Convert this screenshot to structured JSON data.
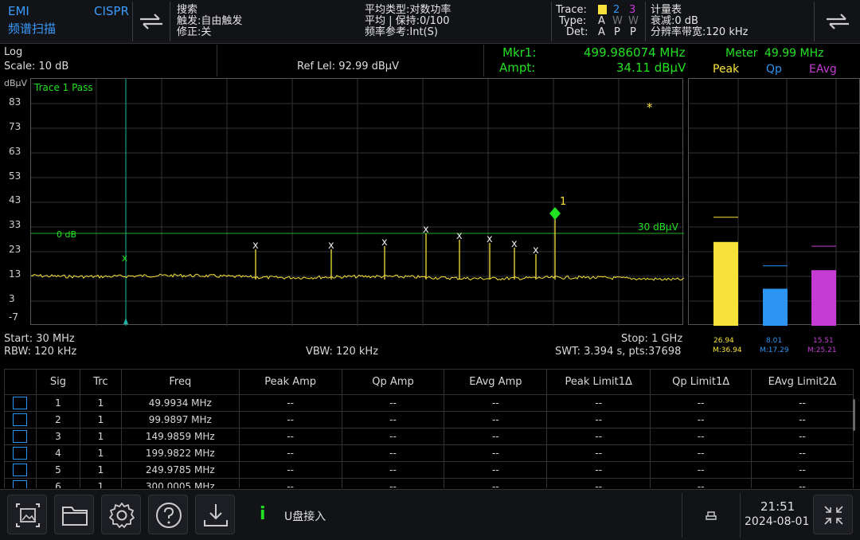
{
  "topbar": {
    "mode_title": "EMI",
    "mode_subtitle": "频谱扫描",
    "standard": "CISPR",
    "search_lines": [
      "搜索",
      "触发:自由触发",
      "修正:关"
    ],
    "avg_lines": [
      "平均类型:对数功率",
      "平均 | 保持:0/100",
      "频率参考:Int(S)"
    ],
    "trace_label": "Trace:",
    "trace_nums": [
      "2",
      "3"
    ],
    "type_label": "Type:",
    "type_values": [
      "A",
      "W",
      "W"
    ],
    "det_label": "Det:",
    "det_values": [
      "A",
      "P",
      "P"
    ],
    "meter_lines": [
      "计量表",
      "衰减:0 dB",
      "分辨率带宽:120 kHz"
    ]
  },
  "header": {
    "scale_type": "Log",
    "scale": "Scale: 10 dB",
    "ref_level": "Ref Lel: 92.99 dBμV",
    "mkr_label": "Mkr1:",
    "mkr_freq": "499.986074 MHz",
    "ampt_label": "Ampt:",
    "ampt_value": "34.11 dBμV",
    "meter_label": "Meter",
    "meter_freq": "49.99 MHz",
    "meter_peak": "Peak",
    "meter_qp": "Qp",
    "meter_eavg": "EAvg"
  },
  "plot": {
    "unit": "dBμV",
    "trace_pass": "Trace 1 Pass",
    "y_ticks": [
      "83",
      "73",
      "63",
      "53",
      "43",
      "33",
      "23",
      "13",
      "3",
      "-7"
    ],
    "limit_left": "0 dB",
    "limit_right": "30 dBμV",
    "marker_num": "1",
    "star": "*",
    "x_mark": "x",
    "colors": {
      "trace": "#f7e23c",
      "grid": "#333",
      "limit": "#1fae1f",
      "marker": "#22e022",
      "cursor": "#1fb5a5"
    }
  },
  "meters": [
    {
      "value": "26.94",
      "max": "M:36.94",
      "level_db": 26.94,
      "max_db": 36.94,
      "color": "#f7e23c"
    },
    {
      "value": "8.01",
      "max": "M:17.29",
      "level_db": 8.01,
      "max_db": 17.29,
      "color": "#2b95f1"
    },
    {
      "value": "15.51",
      "max": "M:25.21",
      "level_db": 15.51,
      "max_db": 25.21,
      "color": "#c53cd4"
    }
  ],
  "footer": {
    "start": "Start: 30 MHz",
    "stop": "Stop: 1 GHz",
    "rbw": "RBW: 120 kHz",
    "vbw": "VBW: 120 kHz",
    "swt": "SWT: 3.394 s, pts:37698"
  },
  "table": {
    "headers": [
      "",
      "Sig",
      "Trc",
      "Freq",
      "Peak Amp",
      "Qp Amp",
      "EAvg Amp",
      "Peak Limit1Δ",
      "Qp Limit1Δ",
      "EAvg Limit2Δ"
    ],
    "rows": [
      [
        "1",
        "1",
        "49.9934 MHz",
        "--",
        "--",
        "--",
        "--",
        "--",
        "--"
      ],
      [
        "2",
        "1",
        "99.9897 MHz",
        "--",
        "--",
        "--",
        "--",
        "--",
        "--"
      ],
      [
        "3",
        "1",
        "149.9859 MHz",
        "--",
        "--",
        "--",
        "--",
        "--",
        "--"
      ],
      [
        "4",
        "1",
        "199.9822 MHz",
        "--",
        "--",
        "--",
        "--",
        "--",
        "--"
      ],
      [
        "5",
        "1",
        "249.9785 MHz",
        "--",
        "--",
        "--",
        "--",
        "--",
        "--"
      ],
      [
        "6",
        "1",
        "300.0005 MHz",
        "--",
        "--",
        "--",
        "--",
        "--",
        "--"
      ]
    ]
  },
  "bottom": {
    "info_icon": "i",
    "status": "U盘接入",
    "time": "21:51",
    "date": "2024-08-01"
  }
}
